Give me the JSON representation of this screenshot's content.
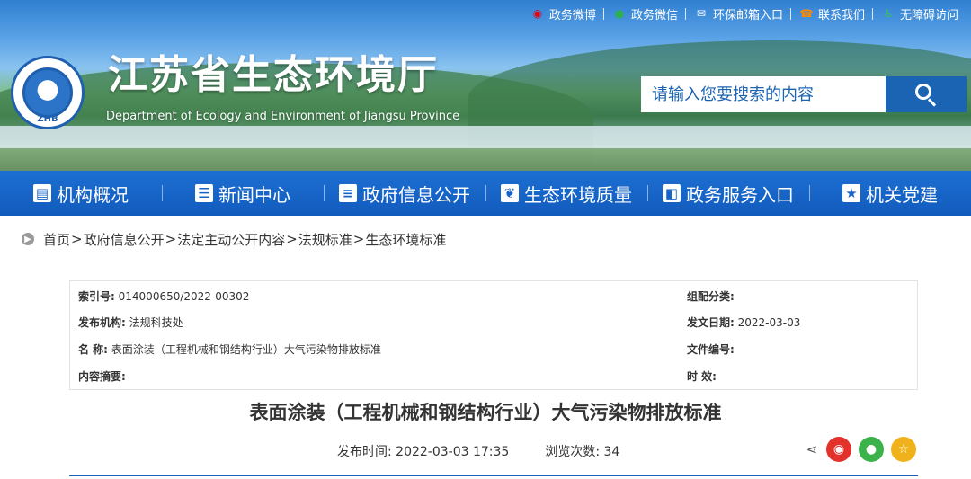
{
  "header": {
    "site_title": "江苏省生态环境厅",
    "site_subtitle": "Department of Ecology and Environment of Jiangsu Province",
    "logo_text": "ZHB",
    "top_links": [
      {
        "label": "政务微博",
        "icon": "weibo-icon"
      },
      {
        "label": "政务微信",
        "icon": "wechat-icon"
      },
      {
        "label": "环保邮箱入口",
        "icon": "mail-icon"
      },
      {
        "label": "联系我们",
        "icon": "phone-icon"
      },
      {
        "label": "无障碍访问",
        "icon": "accessibility-icon"
      }
    ],
    "search": {
      "placeholder": "请输入您要搜索的内容"
    }
  },
  "nav": {
    "items": [
      {
        "label": "机构概况",
        "icon": "document-icon"
      },
      {
        "label": "新闻中心",
        "icon": "newspaper-icon"
      },
      {
        "label": "政府信息公开",
        "icon": "list-icon"
      },
      {
        "label": "生态环境质量",
        "icon": "leaf-icon"
      },
      {
        "label": "政务服务入口",
        "icon": "book-icon"
      },
      {
        "label": "机关党建",
        "icon": "party-emblem-icon"
      }
    ]
  },
  "breadcrumb": {
    "items": [
      "首页",
      "政府信息公开",
      "法定主动公开内容",
      "法规标准",
      "生态环境标准"
    ],
    "separator": ">"
  },
  "meta": {
    "index_label": "索引号:",
    "index_value": "014000650/2022-00302",
    "category_label": "组配分类:",
    "category_value": "",
    "publisher_label": "发布机构:",
    "publisher_value": "法规科技处",
    "issue_date_label": "发文日期:",
    "issue_date_value": "2022-03-03",
    "name_label": "名 称:",
    "name_value": "表面涂装（工程机械和钢结构行业）大气污染物排放标准",
    "doc_number_label": "文件编号:",
    "doc_number_value": "",
    "summary_label": "内容摘要:",
    "summary_value": "",
    "validity_label": "时 效:",
    "validity_value": ""
  },
  "article": {
    "title": "表面涂装（工程机械和钢结构行业）大气污染物排放标准",
    "publish_time_label": "发布时间:",
    "publish_time": "2022-03-03 17:35",
    "views_label": "浏览次数:",
    "views": "34"
  },
  "colors": {
    "primary": "#1b63b3",
    "nav": "#1565c8",
    "weibo": "#e3322b",
    "wechat": "#3bb24a",
    "star": "#f0b21a"
  }
}
